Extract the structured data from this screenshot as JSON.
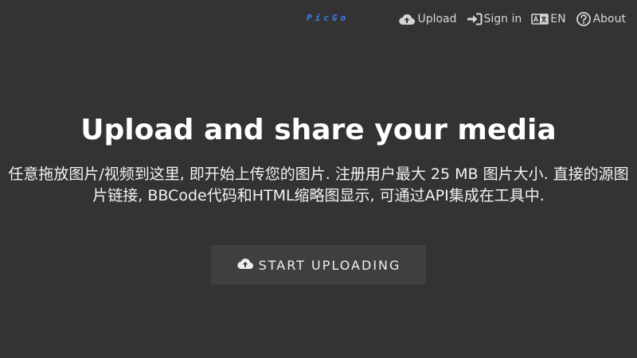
{
  "header": {
    "logo_text": "PicGo",
    "nav": {
      "upload_label": "Upload",
      "signin_label": "Sign in",
      "language_label": "EN",
      "about_label": "About"
    }
  },
  "hero": {
    "title": "Upload and share your media",
    "description": "任意拖放图片/视频到这里, 即开始上传您的图片. 注册用户最大 25 MB 图片大小. 直接的源图片链接, BBCode代码和HTML缩略图显示, 可通过API集成在工具中.",
    "button_label": "START UPLOADING"
  },
  "icons": {
    "upload": "cloud-upload-icon",
    "signin": "sign-in-icon",
    "language": "language-icon",
    "about": "question-circle-icon"
  },
  "colors": {
    "background": "#333333",
    "logo": "#3b82f6",
    "button_bg": "#3f3f3f"
  }
}
